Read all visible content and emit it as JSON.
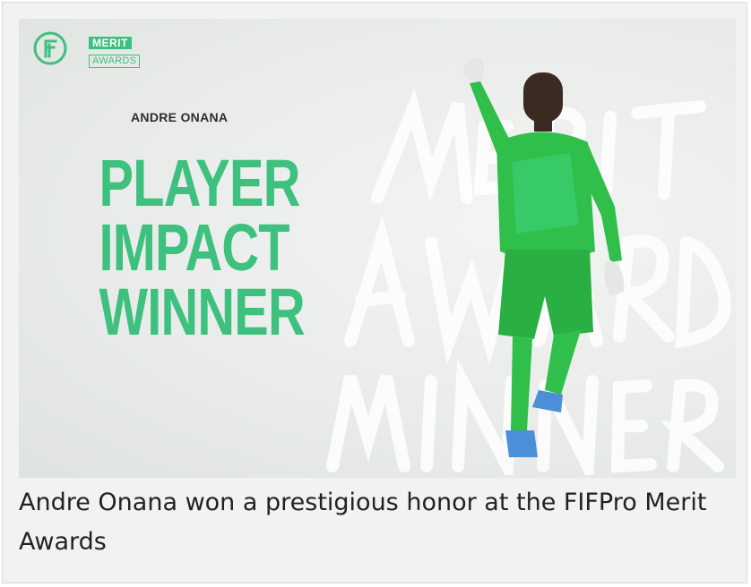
{
  "hero": {
    "logo_icon": "fifpro-f-logo",
    "badge": {
      "top": "MERIT",
      "bottom": "AWARDS"
    },
    "player_name": "ANDRE ONANA",
    "headline": [
      "PLAYER",
      "IMPACT",
      "WINNER"
    ],
    "background_script": [
      "MERIT",
      "AWARD",
      "WINNER"
    ],
    "colors": {
      "accent": "#3ec07f",
      "kit": "#2fbf4a",
      "background": "#e9ecea"
    }
  },
  "caption": {
    "text": "Andre Onana won a prestigious honor at the FIFPro Merit Awards"
  }
}
